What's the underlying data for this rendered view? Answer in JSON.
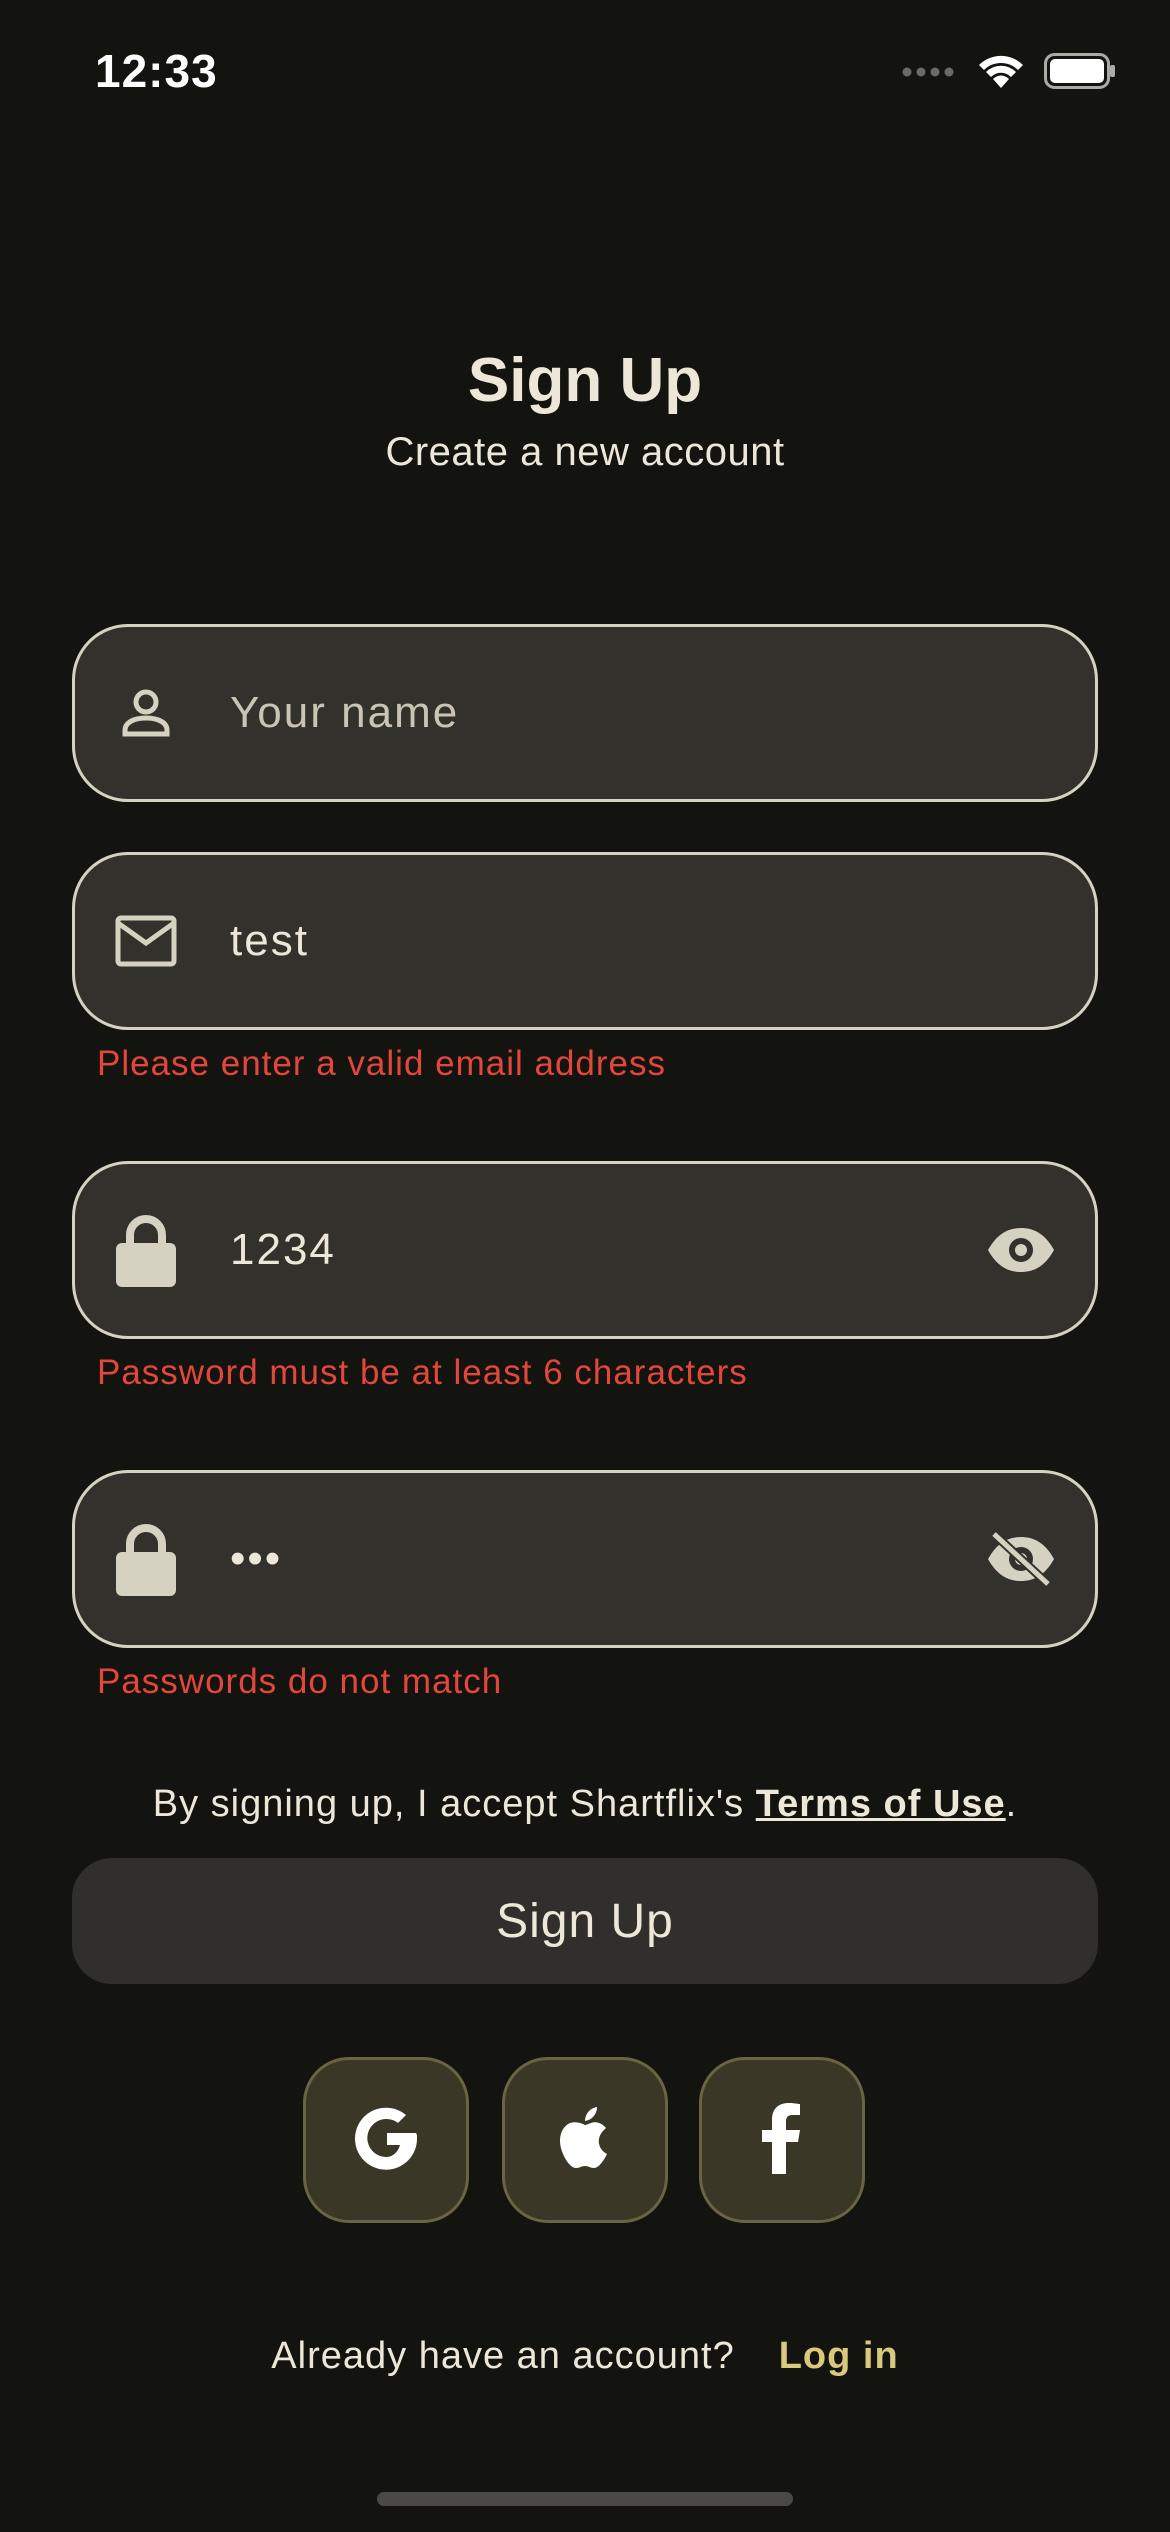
{
  "status_bar": {
    "time": "12:33",
    "icons": [
      "signal-icon",
      "wifi-icon",
      "battery-icon"
    ]
  },
  "header": {
    "title": "Sign Up",
    "subtitle": "Create a new account"
  },
  "fields": {
    "name": {
      "placeholder": "Your name",
      "value": "",
      "icon": "person-icon"
    },
    "email": {
      "value": "test",
      "icon": "envelope-icon",
      "error": "Please enter a valid email address"
    },
    "password": {
      "value": "1234",
      "icon": "lock-icon",
      "toggle_icon": "eye-icon",
      "error": "Password must be at least 6 characters"
    },
    "confirm_password": {
      "value": "•••",
      "icon": "lock-icon",
      "toggle_icon": "eye-off-icon",
      "error": "Passwords do not match"
    }
  },
  "terms": {
    "prefix": "By signing up, I accept Shartflix's ",
    "link": "Terms of Use",
    "suffix": "."
  },
  "signup_button": {
    "label": "Sign Up"
  },
  "social": [
    "google-icon",
    "apple-icon",
    "facebook-icon"
  ],
  "footer": {
    "question": "Already have an account?",
    "login_link": "Log in"
  },
  "colors": {
    "background": "#13130f",
    "field": "#32312c",
    "error": "#e3473b",
    "accent": "#d9c97c",
    "social_bg": "#3a3726"
  }
}
